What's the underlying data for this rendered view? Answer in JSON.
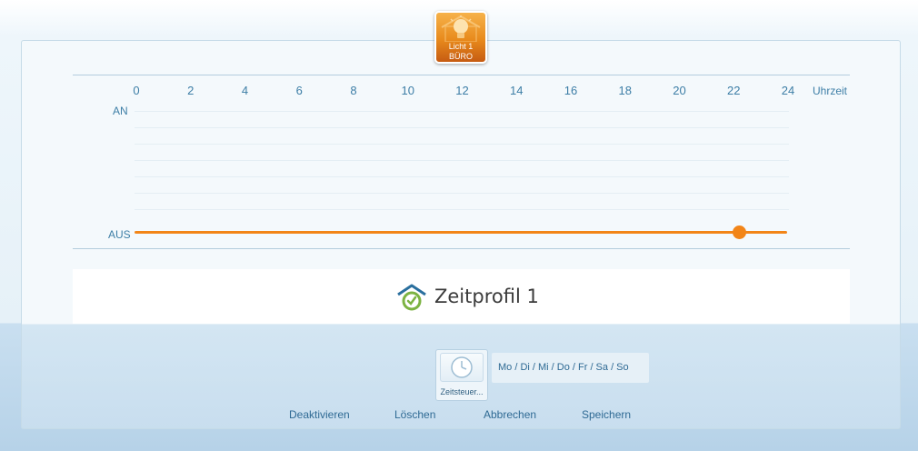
{
  "device": {
    "name": "Licht 1",
    "room": "BÜRO",
    "icon": "light-bulb-icon",
    "color": "#e88a1c"
  },
  "chart_data": {
    "type": "line",
    "title": "",
    "xlabel": "Uhrzeit",
    "ylabel": "",
    "x_ticks": [
      "0",
      "2",
      "4",
      "6",
      "8",
      "10",
      "12",
      "14",
      "16",
      "18",
      "20",
      "22",
      "24"
    ],
    "xlim": [
      0,
      24
    ],
    "y_categories": [
      "AN",
      "AUS"
    ],
    "series": [
      {
        "values": [
          {
            "x": 0,
            "y": "AUS"
          },
          {
            "x": 24,
            "y": "AUS"
          }
        ],
        "color": "#f28518"
      }
    ],
    "markers": [
      {
        "x": 22.2,
        "y": "AUS"
      }
    ],
    "grid": true
  },
  "profile": {
    "title": "Zeitprofil 1",
    "icon": "home-clock-icon"
  },
  "schedule": {
    "tile_label": "Zeitsteuer...",
    "tile_icon": "clock-icon",
    "days": "Mo / Di / Mi / Do / Fr / Sa / So"
  },
  "actions": {
    "deactivate": "Deaktivieren",
    "delete": "Löschen",
    "cancel": "Abbrechen",
    "save": "Speichern"
  },
  "colors": {
    "accent": "#f28518",
    "text_blue": "#3d7ea6"
  }
}
